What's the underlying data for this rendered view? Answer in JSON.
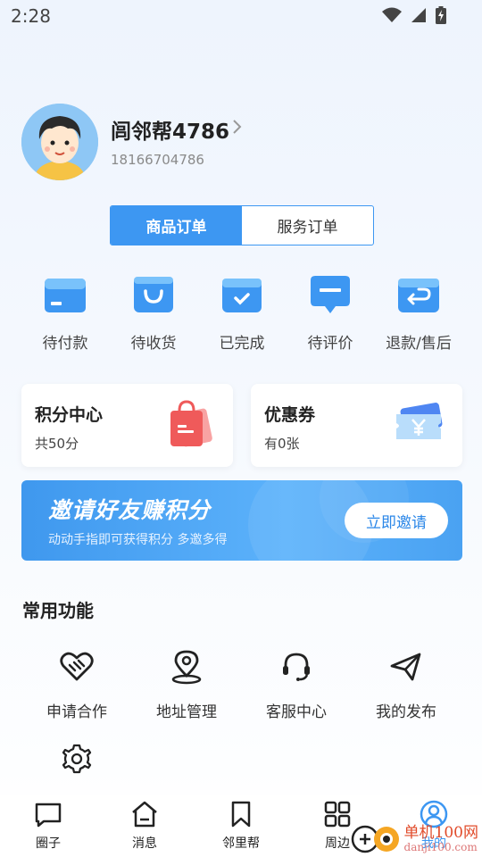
{
  "status_bar": {
    "time": "2:28"
  },
  "profile": {
    "name": "闾邻帮4786",
    "phone": "18166704786"
  },
  "order_tabs": {
    "goods": "商品订单",
    "service": "服务订单"
  },
  "order_status": [
    {
      "label": "待付款"
    },
    {
      "label": "待收货"
    },
    {
      "label": "已完成"
    },
    {
      "label": "待评价"
    },
    {
      "label": "退款/售后"
    }
  ],
  "points_card": {
    "title": "积分中心",
    "sub": "共50分"
  },
  "coupon_card": {
    "title": "优惠券",
    "sub": "有0张"
  },
  "invite": {
    "title": "邀请好友赚积分",
    "sub": "动动手指即可获得积分 多邀多得",
    "button": "立即邀请"
  },
  "common": {
    "title": "常用功能",
    "items": [
      {
        "label": "申请合作"
      },
      {
        "label": "地址管理"
      },
      {
        "label": "客服中心"
      },
      {
        "label": "我的发布"
      }
    ]
  },
  "bottom_nav": [
    {
      "label": "圈子"
    },
    {
      "label": "消息"
    },
    {
      "label": "邻里帮"
    },
    {
      "label": "周边"
    },
    {
      "label": "我的"
    }
  ],
  "watermark": {
    "line1": "单机100网",
    "line2": "danji100.com"
  },
  "colors": {
    "accent": "#3d97f2",
    "background": "#f0f5fd"
  }
}
